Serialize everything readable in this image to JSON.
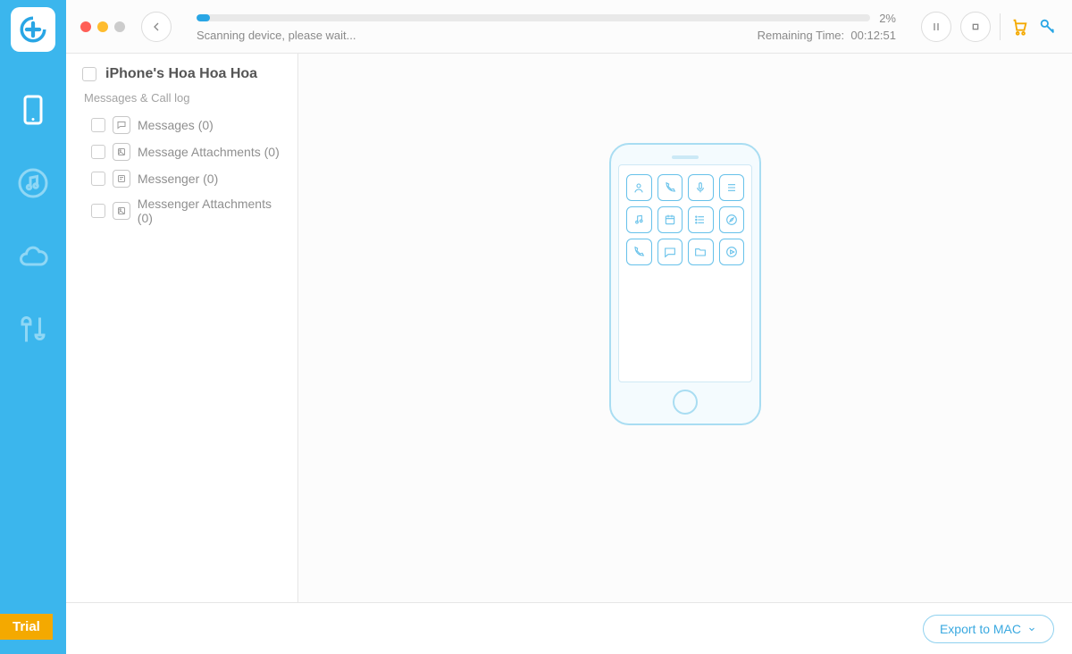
{
  "sidebar": {
    "trial_label": "Trial"
  },
  "progress": {
    "status_text": "Scanning device, please wait...",
    "remaining_label": "Remaining Time:",
    "remaining_time": "00:12:51",
    "percent_text": "2%",
    "percent_value": 2
  },
  "panel": {
    "device_name": "iPhone's Hoa Hoa Hoa",
    "section_label": "Messages & Call log",
    "items": [
      {
        "label": "Messages (0)"
      },
      {
        "label": "Message Attachments (0)"
      },
      {
        "label": "Messenger (0)"
      },
      {
        "label": "Messenger Attachments (0)"
      }
    ]
  },
  "footer": {
    "export_label": "Export to MAC"
  }
}
